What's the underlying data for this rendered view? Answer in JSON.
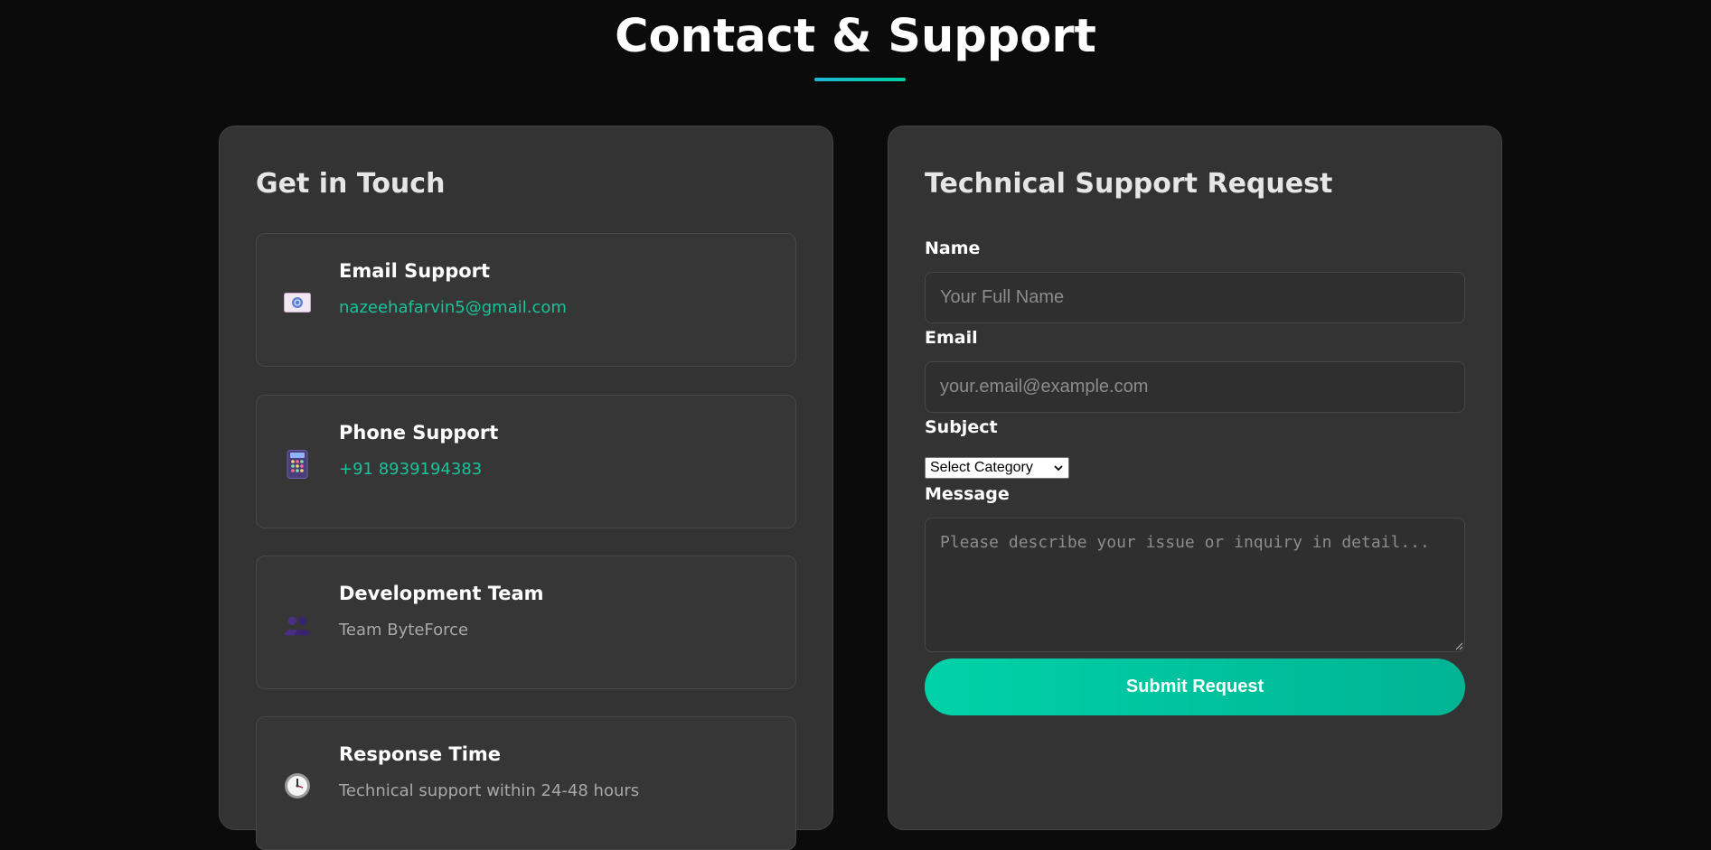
{
  "page": {
    "title": "Contact & Support"
  },
  "contact": {
    "heading": "Get in Touch",
    "items": [
      {
        "icon": "email-icon",
        "title": "Email Support",
        "value": "nazeehafarvin5@gmail.com",
        "tone": "accent"
      },
      {
        "icon": "phone-icon",
        "title": "Phone Support",
        "value": "+91 8939194383",
        "tone": "accent"
      },
      {
        "icon": "team-icon",
        "title": "Development Team",
        "value": "Team ByteForce",
        "tone": "muted"
      },
      {
        "icon": "clock-icon",
        "title": "Response Time",
        "value": "Technical support within 24-48 hours",
        "tone": "muted"
      }
    ]
  },
  "form": {
    "heading": "Technical Support Request",
    "name_label": "Name",
    "name_placeholder": "Your Full Name",
    "name_value": "",
    "email_label": "Email",
    "email_placeholder": "your.email@example.com",
    "email_value": "",
    "subject_label": "Subject",
    "subject_selected": "Select Category",
    "message_label": "Message",
    "message_placeholder": "Please describe your issue or inquiry in detail...",
    "submit_label": "Submit Request"
  },
  "colors": {
    "background": "#0b0b0b",
    "card": "#333333",
    "accent": "#00d1a0",
    "accent_text": "#19c39a"
  }
}
